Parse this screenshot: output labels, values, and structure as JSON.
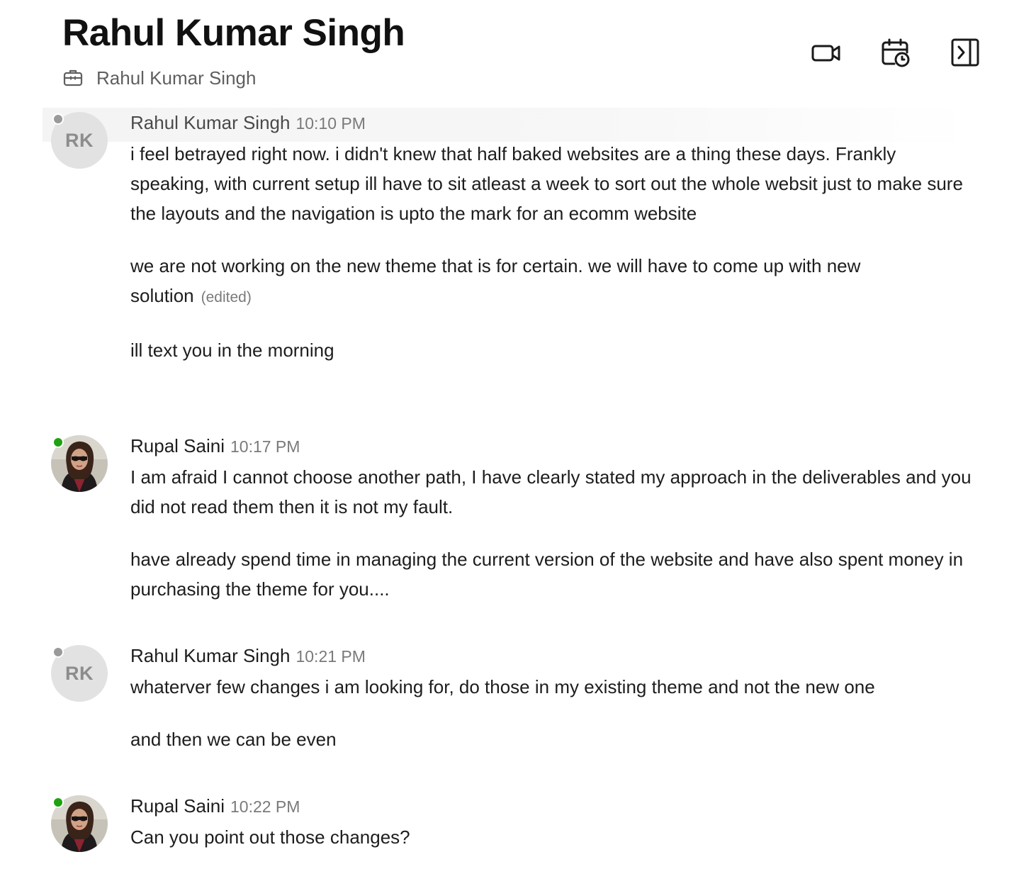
{
  "header": {
    "title": "Rahul Kumar Singh",
    "subtitle": "Rahul Kumar Singh",
    "subtitle_icon": "briefcase-icon",
    "actions": [
      {
        "icon": "video-camera-icon"
      },
      {
        "icon": "calendar-clock-icon"
      },
      {
        "icon": "sidebar-toggle-icon"
      }
    ]
  },
  "colors": {
    "presence_online": "#1fa20f",
    "presence_away": "#9a9a9a",
    "avatar_initials_bg": "#e2e2e2"
  },
  "messages": [
    {
      "sender": "Rahul Kumar Singh",
      "time": "10:10 PM",
      "avatar_initials": "RK",
      "presence": "away",
      "paragraphs": [
        "i feel betrayed right now. i didn't knew that half baked websites are a thing these days. Frankly speaking, with current setup ill have to sit atleast a week to sort out the whole websit just to make sure the layouts and the navigation is upto the mark for an ecomm website",
        "we are not working on the new theme that is for certain. we will have to come up with new solution",
        "ill text you in the morning"
      ],
      "edited_label": "(edited)"
    },
    {
      "sender": "Rupal Saini",
      "time": "10:17 PM",
      "avatar_image": "user-photo",
      "presence": "online",
      "paragraphs": [
        "I am afraid I cannot choose another path, I have clearly stated my approach in the deliverables and you did not read them then it is not my fault.",
        "have already spend time in managing the current version of the website and have also spent money in purchasing the theme for you...."
      ]
    },
    {
      "sender": "Rahul Kumar Singh",
      "time": "10:21 PM",
      "avatar_initials": "RK",
      "presence": "away",
      "paragraphs": [
        "whaterver few changes i am looking for, do those in my existing theme and not the new one",
        "and then we can be even"
      ]
    },
    {
      "sender": "Rupal Saini",
      "time": "10:22 PM",
      "avatar_image": "user-photo",
      "presence": "online",
      "paragraphs": [
        "Can you point out those changes?"
      ]
    }
  ]
}
